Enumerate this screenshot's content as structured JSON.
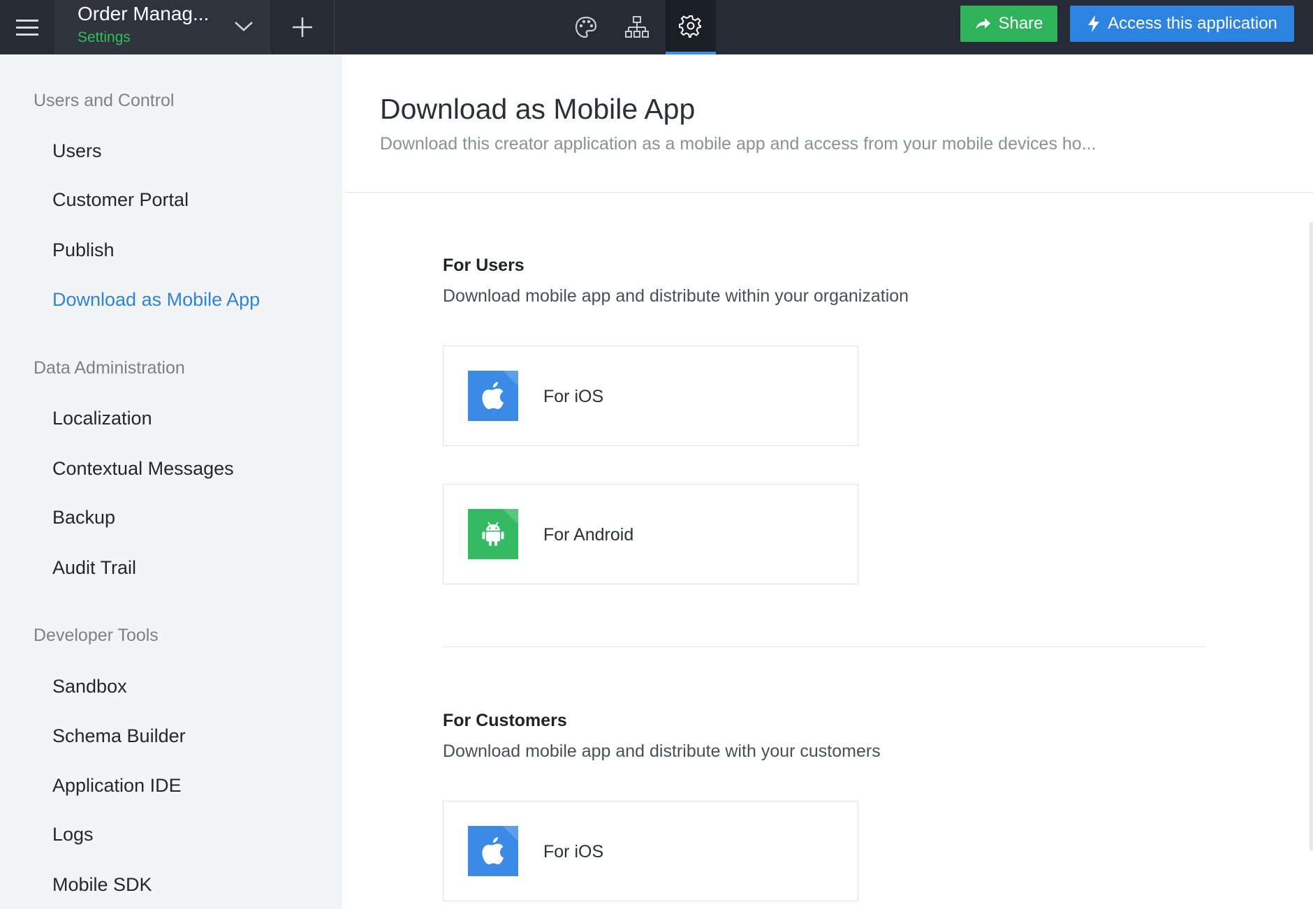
{
  "topbar": {
    "app_name": "Order Manag...",
    "app_subtitle": "Settings",
    "share_label": "Share",
    "access_label": "Access this application",
    "icons": [
      "menu-icon",
      "chevron-down-icon",
      "plus-icon",
      "palette-icon",
      "sitemap-icon",
      "gear-icon",
      "share-arrow-icon",
      "lightning-icon"
    ],
    "colors": {
      "bar": "#262b35",
      "share": "#2eb35a",
      "access": "#2c83e0",
      "active_tab": "#3b8de6"
    }
  },
  "sidebar": {
    "groups": [
      {
        "label": "Users and Control",
        "items": [
          "Users",
          "Customer Portal",
          "Publish",
          "Download as Mobile App"
        ]
      },
      {
        "label": "Data Administration",
        "items": [
          "Localization",
          "Contextual Messages",
          "Backup",
          "Audit Trail"
        ]
      },
      {
        "label": "Developer Tools",
        "items": [
          "Sandbox",
          "Schema Builder",
          "Application IDE",
          "Logs",
          "Mobile SDK"
        ]
      }
    ],
    "active_item": "Download as Mobile App"
  },
  "main": {
    "title": "Download as Mobile App",
    "description": "Download this creator application as a mobile app and access from your mobile devices ho...",
    "sections": [
      {
        "title": "For Users",
        "description": "Download mobile app and distribute within your organization",
        "cards": [
          {
            "label": "For iOS",
            "icon": "apple-icon"
          },
          {
            "label": "For Android",
            "icon": "android-icon"
          }
        ]
      },
      {
        "title": "For Customers",
        "description": "Download mobile app and distribute with your customers",
        "cards": [
          {
            "label": "For iOS",
            "icon": "apple-icon"
          }
        ]
      }
    ]
  }
}
